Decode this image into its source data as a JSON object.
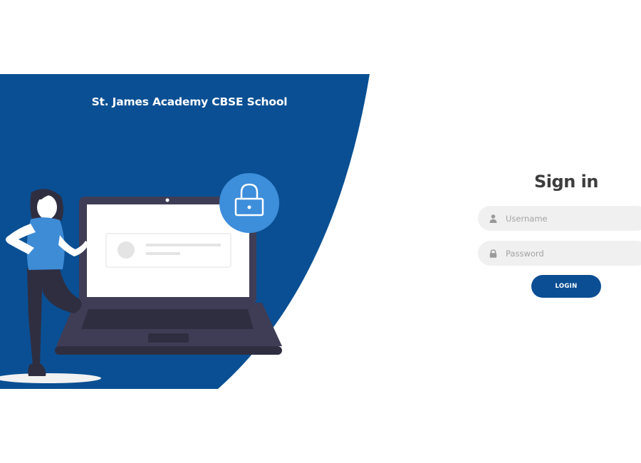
{
  "brand": {
    "school_name": "St. James Academy CBSE School",
    "panel_color": "#0a4f93",
    "lock_badge_color": "#3d8edb",
    "person_shirt_color": "#3e8bd6"
  },
  "login_form": {
    "title": "Sign in",
    "username": {
      "placeholder": "Username",
      "value": "",
      "icon": "user-icon"
    },
    "password": {
      "placeholder": "Password",
      "value": "",
      "icon": "lock-icon"
    },
    "submit_label": "LOGIN",
    "submit_color": "#0c4e93"
  }
}
